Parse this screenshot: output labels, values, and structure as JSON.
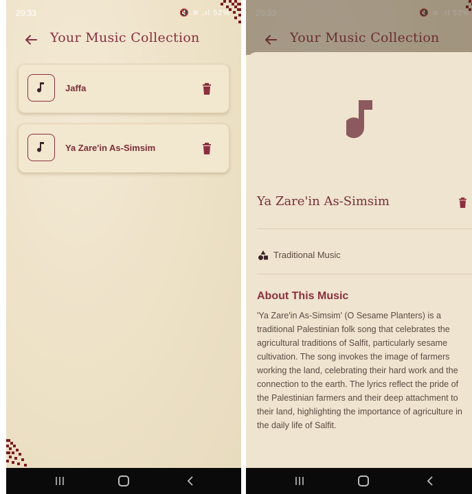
{
  "status": {
    "time": "20:33",
    "icons_text": "🔇 ≋ .ıl 52%"
  },
  "appbar": {
    "title": "Your Music Collection"
  },
  "collection": {
    "items": [
      {
        "label": "Jaffa"
      },
      {
        "label": "Ya Zare'in As-Simsim"
      }
    ]
  },
  "detail": {
    "title": "Ya Zare'in As-Simsim",
    "category": "Traditional Music",
    "about_heading": "About This Music",
    "about_text": "'Ya Zare'in As-Simsim' (O Sesame Planters) is a traditional Palestinian folk song that celebrates the agricultural traditions of Salfit, particularly sesame cultivation. The song invokes the image of farmers working the land, celebrating their hard work and the connection to the earth. The lyrics reflect the pride of the Palestinian farmers and their deep attachment to their land, highlighting the importance of agriculture in the daily life of Salfit."
  },
  "icons": {
    "back": "arrow-left-icon",
    "music": "music-note-icon",
    "delete": "trash-icon",
    "category": "shapes-icon",
    "nav": [
      "recent-apps-icon",
      "home-icon",
      "nav-back-icon"
    ]
  },
  "colors": {
    "background": "#efe4cc",
    "accent": "#8a3040",
    "card": "#f2e7cf",
    "navbar": "#0a0a0a"
  }
}
